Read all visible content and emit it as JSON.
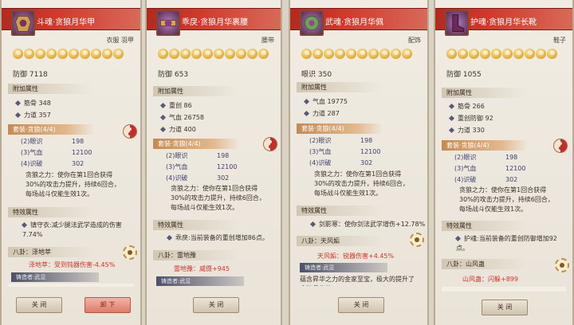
{
  "panels": [
    {
      "title": "斗魂·贪狼月华甲",
      "slot": "衣服 羽甲",
      "stat": "防御 7118",
      "attr_header": "附加属性",
      "attrs": [
        "筋骨  348",
        "力道  357"
      ],
      "set_header": "套装·贪狼(4/4)",
      "set_rows": [
        [
          "(2)眼识",
          "198"
        ],
        [
          "(3)气血",
          "12100"
        ],
        [
          "(4)识破",
          "302"
        ]
      ],
      "set_desc": "贪狼之力：使你在第1回合获得30%的攻击力提升，持续6回合，每场战斗仅能生效1次。",
      "effect_header": "特效属性",
      "effect": "镇守衣:减少腿法武学造成的伤害7.74%",
      "bagua_header": "八卦：泽地萃",
      "bagua_value": "泽地萃：受到钝器伤害-4.45%",
      "maker": "铸造者:武显",
      "buttons": [
        "关 闭",
        "卸 下"
      ]
    },
    {
      "title": "乖戾·贪狼月华裹腰",
      "slot": "腰带",
      "stat": "防御 653",
      "attr_header": "附加属性",
      "attrs": [
        "重创  86",
        "气血  26758",
        "力道  400"
      ],
      "set_header": "套装·贪狼(4/4)",
      "set_rows": [
        [
          "(2)眼识",
          "198"
        ],
        [
          "(3)气血",
          "12100"
        ],
        [
          "(4)识破",
          "302"
        ]
      ],
      "set_desc": "贪狼之力：使你在第1回合获得30%的攻击力提升，持续6回合，每场战斗仅能生效1次。",
      "effect_header": "特效属性",
      "effect": "乖戾:当前装备的重创增加86点。",
      "bagua_header": "八卦：雷地豫",
      "bagua_value": "雷地豫：威慑+945",
      "maker": "铸造者:武显",
      "buttons": [
        "关 闭"
      ]
    },
    {
      "title": "武魂·贪狼月华佩",
      "slot": "配饰",
      "stat": "眼识 350",
      "attr_header": "附加属性",
      "attrs": [
        "气血  19775",
        "力道  287"
      ],
      "set_header": "套装·贪狼(4/4)",
      "set_rows": [
        [
          "(2)眼识",
          "198"
        ],
        [
          "(3)气血",
          "12100"
        ],
        [
          "(4)识破",
          "302"
        ]
      ],
      "set_desc": "贪狼之力：使你在第1回合获得30%的攻击力提升，持续6回合，每场战斗仅能生效1次。",
      "effect_header": "特效属性",
      "effect": "剑影寒：使你剑法武学增伤+12.78%",
      "bagua_header": "八卦：天风姤",
      "bagua_value": "天风姤：锐器伤害+4.45%",
      "maker": "铸造者:武显",
      "maker_note": "蕴含昇华之力的金家至宝，极大的提升了贪狼月华的",
      "buttons": [
        "关 闭"
      ]
    },
    {
      "title": "护魂·贪狼月华长靴",
      "slot": "鞋子",
      "stat": "防御 1055",
      "attr_header": "附加属性",
      "attrs": [
        "筋骨  266",
        "重创防御  92",
        "力道  330"
      ],
      "set_header": "套装·贪狼(4/4)",
      "set_rows": [
        [
          "(2)眼识",
          "198"
        ],
        [
          "(3)气血",
          "12100"
        ],
        [
          "(4)识破",
          "302"
        ]
      ],
      "set_desc": "贪狼之力：使你在第1回合获得30%的攻击力提升，持续6回合，每场战斗仅能生效1次。",
      "effect_header": "特效属性",
      "effect": "护魂:当前装备的重创防御增加92点。",
      "bagua_header": "八卦：山风蛊",
      "bagua_value": "山风蛊：闪躲+899",
      "buttons": [
        "关 闭"
      ]
    }
  ],
  "icons": [
    "armor-icon",
    "belt-icon",
    "pendant-icon",
    "boots-icon"
  ]
}
